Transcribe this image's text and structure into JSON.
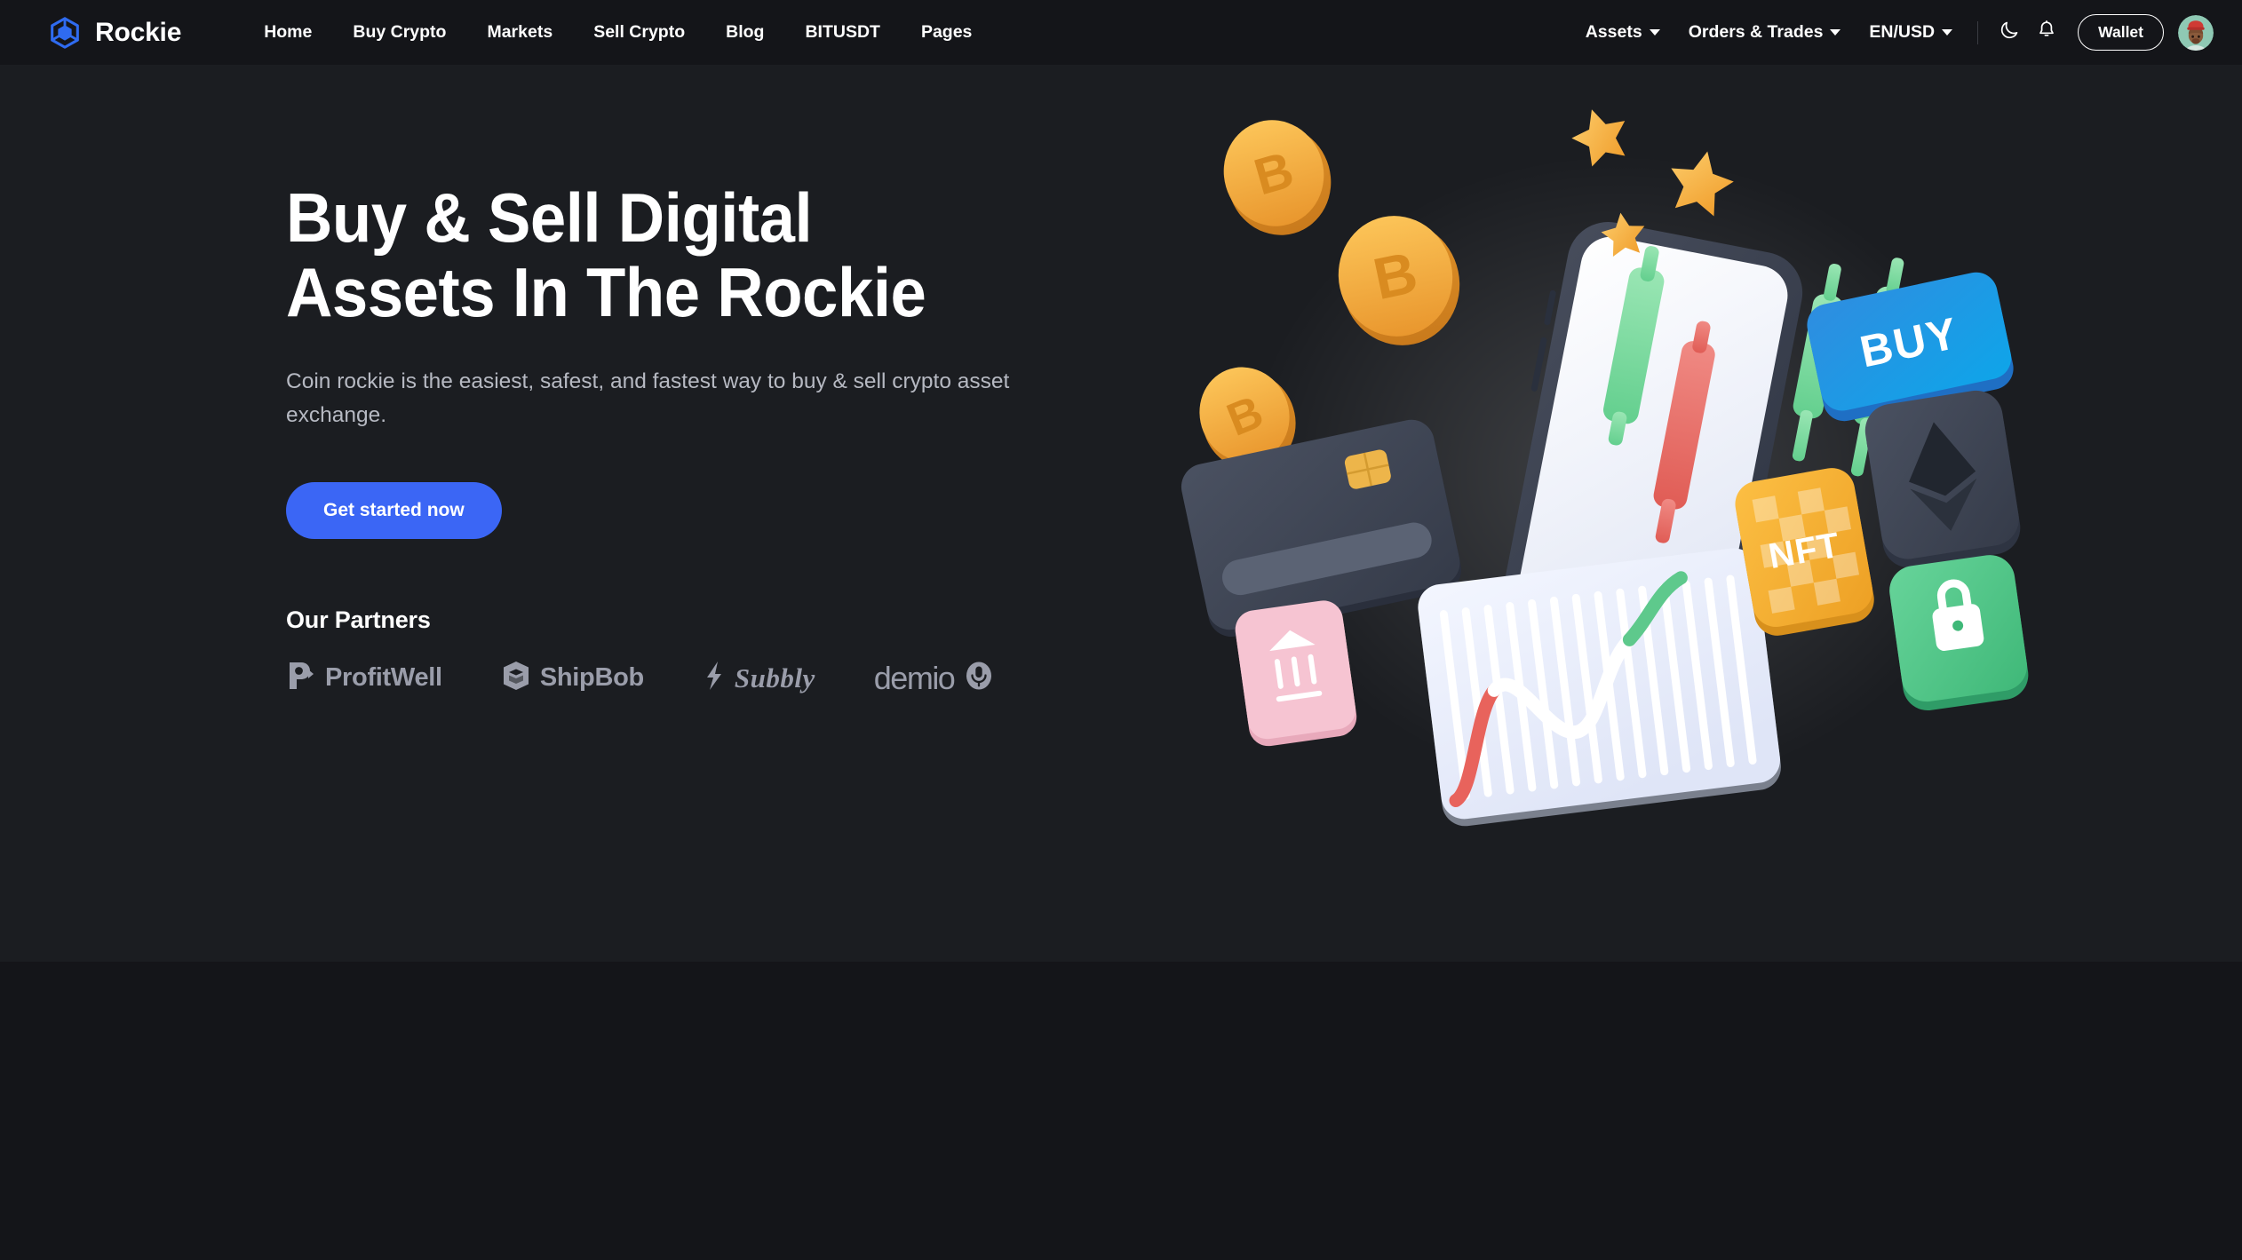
{
  "brand": {
    "name": "Rockie",
    "logo_icon": "cube-logo-icon",
    "logo_color": "#2f6bf0"
  },
  "nav": {
    "links": [
      {
        "label": "Home",
        "name": "nav-link-home"
      },
      {
        "label": "Buy Crypto",
        "name": "nav-link-buy-crypto"
      },
      {
        "label": "Markets",
        "name": "nav-link-markets"
      },
      {
        "label": "Sell Crypto",
        "name": "nav-link-sell-crypto"
      },
      {
        "label": "Blog",
        "name": "nav-link-blog"
      },
      {
        "label": "BITUSDT",
        "name": "nav-link-bitusdt"
      },
      {
        "label": "Pages",
        "name": "nav-link-pages"
      }
    ],
    "dropdowns": [
      {
        "label": "Assets"
      },
      {
        "label": "Orders & Trades"
      },
      {
        "label": "EN/USD"
      }
    ],
    "theme_toggle_icon": "moon-icon",
    "notifications_icon": "bell-icon",
    "wallet_label": "Wallet",
    "avatar_alt": "user-avatar"
  },
  "hero": {
    "title_line1": "Buy & Sell Digital",
    "title_line2": "Assets In The Rockie",
    "subtitle": "Coin rockie is the easiest, safest, and fastest way to buy & sell crypto asset exchange.",
    "cta_label": "Get started now",
    "cta_color": "#3b66f5",
    "background": "#1b1d21"
  },
  "partners": {
    "heading": "Our Partners",
    "logo_color": "#a5a8b6",
    "items": [
      {
        "label": "ProfitWell",
        "icon": "profitwell-mark-icon",
        "style": "bold"
      },
      {
        "label": "ShipBob",
        "icon": "shipbob-box-icon",
        "style": "bold"
      },
      {
        "label": "Subbly",
        "icon": "subbly-bolt-icon",
        "style": "script"
      },
      {
        "label": "demio",
        "icon": "demio-mic-icon",
        "style": "light"
      }
    ]
  },
  "illustration": {
    "name": "crypto-trading-3d-illustration",
    "elements": [
      "bitcoin-coin",
      "bitcoin-coin",
      "bitcoin-coin",
      "star",
      "star",
      "star",
      "smartphone-candlestick-chart",
      "candlestick-green",
      "candlestick-red",
      "buy-button-3d",
      "ethereum-card",
      "nft-card",
      "lock-card",
      "bank-card",
      "credit-card",
      "line-chart-card"
    ],
    "buy_button_label": "BUY",
    "nft_card_label": "NFT"
  }
}
